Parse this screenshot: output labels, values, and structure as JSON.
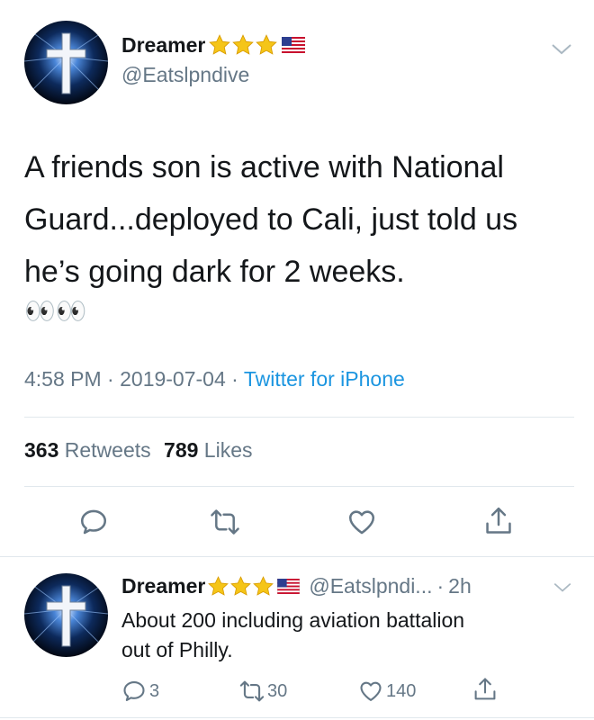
{
  "main_tweet": {
    "display_name": "Dreamer",
    "handle": "@Eatslpndive",
    "badges": [
      "star-icon",
      "star-icon",
      "star-icon",
      "us-flag-icon"
    ],
    "text_lines": [
      "A friends son is active with National",
      "Guard...deployed to Cali, just told us",
      "he’s going dark for 2 weeks."
    ],
    "emoji": "👀👀",
    "time": "4:58 PM",
    "date": "2019-07-04",
    "separator": "·",
    "source": "Twitter for iPhone",
    "retweets_count": "363",
    "retweets_label": "Retweets",
    "likes_count": "789",
    "likes_label": "Likes"
  },
  "reply_tweet": {
    "display_name": "Dreamer",
    "handle": "@Eatslpndi...",
    "separator": "·",
    "age": "2h",
    "text_lines": [
      "About 200 including aviation battalion",
      "out of Philly."
    ],
    "reply_count": "3",
    "retweet_count": "30",
    "like_count": "140"
  },
  "colors": {
    "text": "#14171a",
    "muted": "#657786",
    "link": "#1b95e0",
    "star": "#f5c518",
    "divider": "#e1e8ed"
  }
}
